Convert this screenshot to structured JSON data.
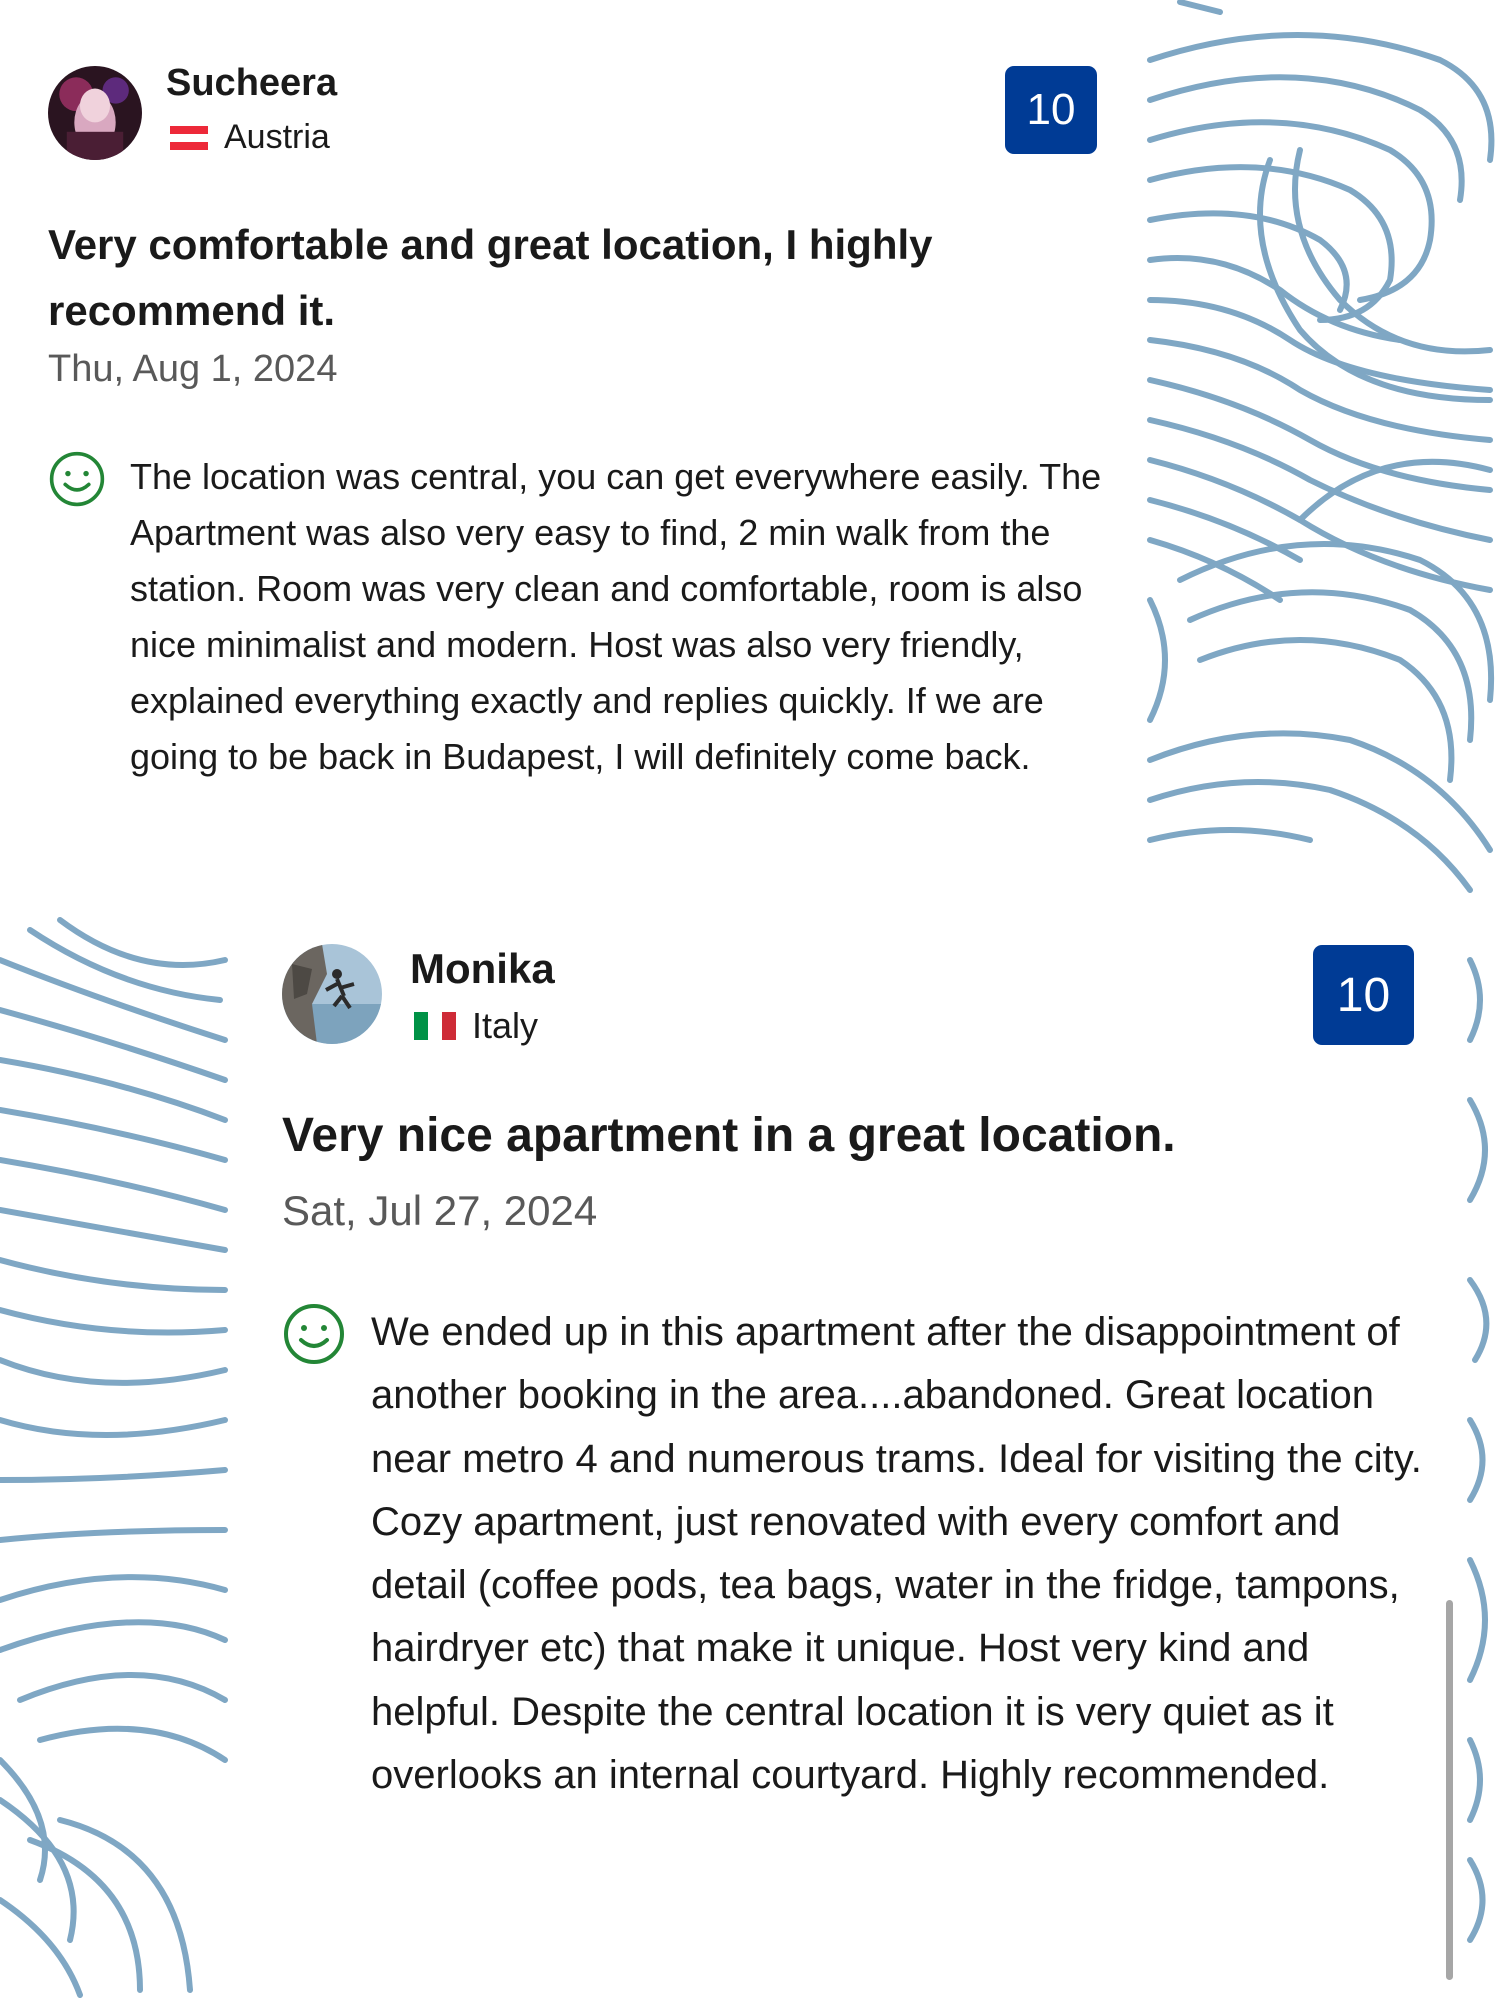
{
  "colors": {
    "background": "#ffffff",
    "wave_pattern": "#7fa7c4",
    "score_badge": "#003b95",
    "smiley": "#238636",
    "text_primary": "#1a1a1a",
    "text_secondary": "#595959"
  },
  "reviews": [
    {
      "reviewer": "Sucheera",
      "country": "Austria",
      "flag_icon": "austria-flag-icon",
      "score": "10",
      "title": "Very comfortable and great location, I highly recommend it.",
      "date": "Thu, Aug 1, 2024",
      "sentiment_icon": "smiley-icon",
      "body": "The location was central, you can get everywhere easily. The Apartment was also very easy to find, 2 min walk from the station. Room was very clean and comfortable, room is also nice minimalist and modern. Host was also very friendly, explained everything exactly and replies quickly. If we are going to be back in Budapest, I will definitely come back."
    },
    {
      "reviewer": "Monika",
      "country": "Italy",
      "flag_icon": "italy-flag-icon",
      "score": "10",
      "title": "Very nice apartment in a great location.",
      "date": "Sat, Jul 27, 2024",
      "sentiment_icon": "smiley-icon",
      "body": "We ended up in this apartment after the disappointment of another booking in the area....abandoned. Great location near metro 4 and numerous trams. Ideal for visiting the city. Cozy apartment, just renovated with every comfort and detail (coffee pods, tea bags, water in the fridge, tampons, hairdryer etc) that make it unique. Host very kind and helpful. Despite the central location it is very quiet as it overlooks an internal courtyard. Highly recommended."
    }
  ]
}
